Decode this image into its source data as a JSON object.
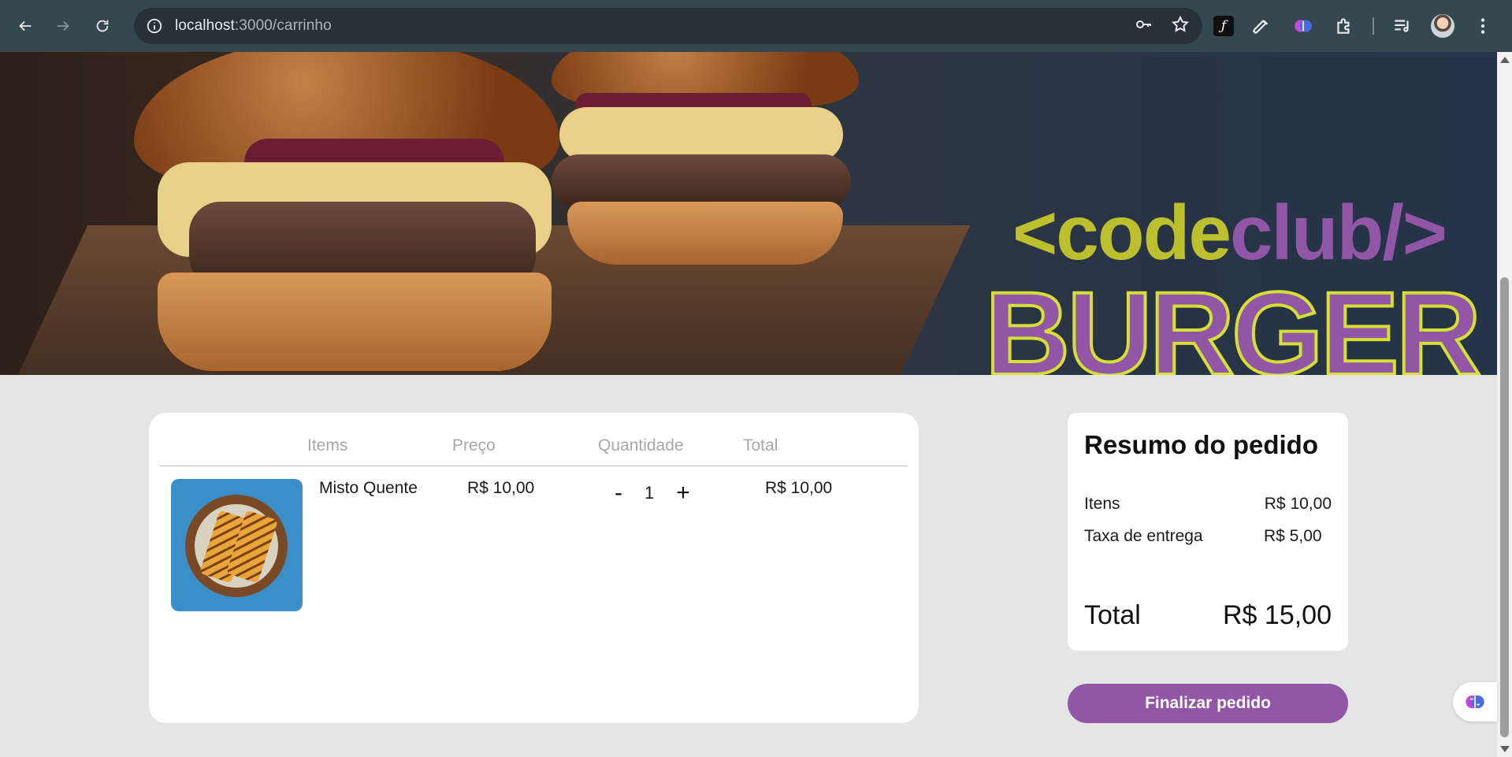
{
  "browser": {
    "url_host": "localhost",
    "url_path": ":3000/carrinho"
  },
  "hero": {
    "logo_code": "<code",
    "logo_club": "club/>",
    "logo_burger": "BURGER"
  },
  "cart": {
    "headers": [
      "Items",
      "Preço",
      "Quantidade",
      "Total"
    ],
    "items": [
      {
        "name": "Misto Quente",
        "price": "R$ 10,00",
        "minus": "-",
        "quantity": "1",
        "plus": "+",
        "total": "R$ 10,00"
      }
    ]
  },
  "summary": {
    "title": "Resumo do pedido",
    "items_label": "Itens",
    "items_value": "R$ 10,00",
    "delivery_label": "Taxa de entrega",
    "delivery_value": "R$ 5,00",
    "total_label": "Total",
    "total_value": "R$ 15,00"
  },
  "checkout_label": "Finalizar pedido",
  "colors": {
    "brand_purple": "#9156a6",
    "brand_green": "#bcc02c",
    "page_bg": "#e5e5e5"
  }
}
